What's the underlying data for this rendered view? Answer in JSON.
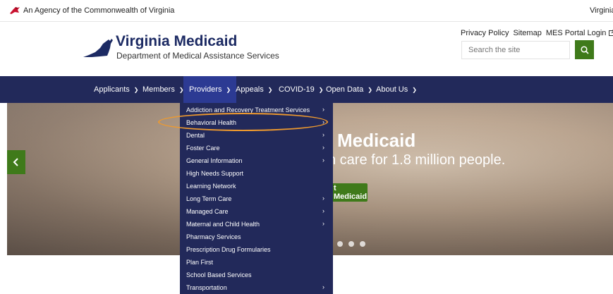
{
  "agency_bar": {
    "text": "An Agency of the Commonwealth of Virginia",
    "va_link": "Virginia.gov"
  },
  "header": {
    "title": "Virginia Medicaid",
    "subtitle": "Department of Medical Assistance Services",
    "links": [
      "Privacy Policy",
      "Sitemap",
      "MES Portal Login"
    ],
    "search_placeholder": "Search the site"
  },
  "nav": {
    "items": [
      {
        "label": "Applicants"
      },
      {
        "label": "Members"
      },
      {
        "label": "Providers"
      },
      {
        "label": "Appeals"
      },
      {
        "label": "COVID-19"
      },
      {
        "label": "Open Data"
      },
      {
        "label": "About Us"
      }
    ]
  },
  "dropdown": {
    "items": [
      {
        "label": "Addiction and Recovery Treatment Services",
        "has_submenu": true
      },
      {
        "label": "Behavioral Health",
        "has_submenu": true
      },
      {
        "label": "Dental",
        "has_submenu": true
      },
      {
        "label": "Foster Care",
        "has_submenu": true
      },
      {
        "label": "General Information",
        "has_submenu": true
      },
      {
        "label": "High Needs Support",
        "has_submenu": false
      },
      {
        "label": "Learning Network",
        "has_submenu": false
      },
      {
        "label": "Long Term Care",
        "has_submenu": true
      },
      {
        "label": "Managed Care",
        "has_submenu": true
      },
      {
        "label": "Maternal and Child Health",
        "has_submenu": true
      },
      {
        "label": "Pharmacy Services",
        "has_submenu": false
      },
      {
        "label": "Prescription Drug Formularies",
        "has_submenu": false
      },
      {
        "label": "Plan First",
        "has_submenu": false
      },
      {
        "label": "School Based Services",
        "has_submenu": false
      },
      {
        "label": "Transportation",
        "has_submenu": true
      }
    ]
  },
  "hero": {
    "title": "Medicaid",
    "subtitle": "n care for 1.8 million people.",
    "button": "t Medicaid"
  },
  "colors": {
    "navy": "#22295a",
    "nav_active": "#2c3a93",
    "green": "#3f7a1a",
    "highlight": "#ef9a2e",
    "brand": "#1c2a63"
  }
}
